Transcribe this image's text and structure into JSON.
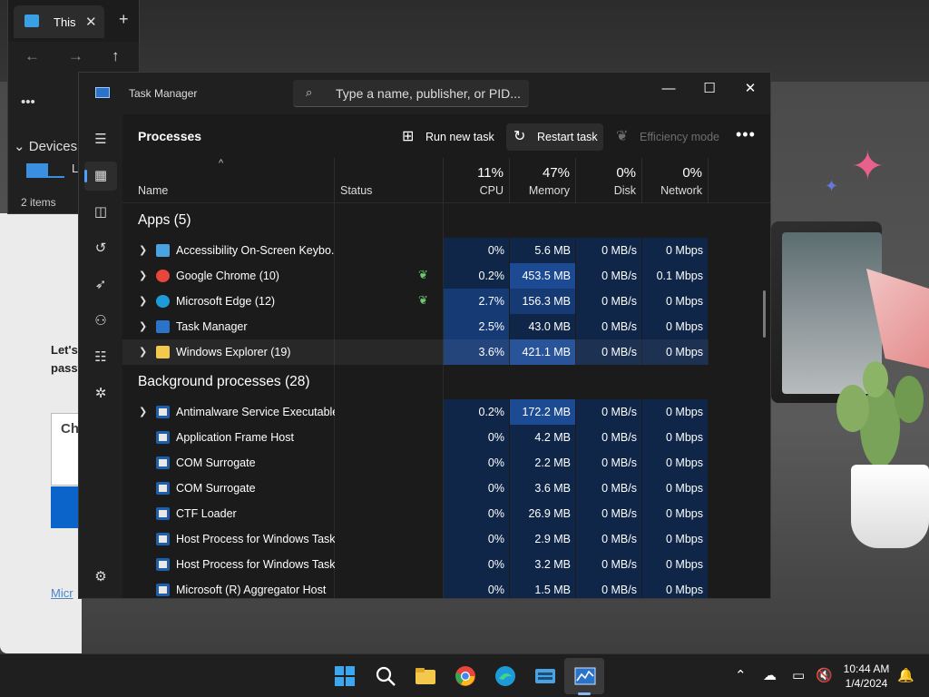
{
  "explorer": {
    "tab_title": "This",
    "section": "Devices a",
    "drive_label": "L",
    "items_count": "2 items"
  },
  "background": {
    "card_title": "Let's passv",
    "card_box_label": "Ch",
    "card_link": "Micr"
  },
  "task_manager": {
    "title": "Task Manager",
    "search_placeholder": "Type a name, publisher, or PID...",
    "page_heading": "Processes",
    "toolbar": {
      "run_new_task": "Run new task",
      "restart_task": "Restart task",
      "efficiency_mode": "Efficiency mode"
    },
    "columns": {
      "name": "Name",
      "status": "Status",
      "cpu_pct": "11%",
      "cpu": "CPU",
      "memory_pct": "47%",
      "memory": "Memory",
      "disk_pct": "0%",
      "disk": "Disk",
      "network_pct": "0%",
      "network": "Network"
    },
    "groups": {
      "apps": "Apps (5)",
      "background": "Background processes (28)"
    },
    "apps": [
      {
        "name": "Accessibility On-Screen Keybo...",
        "status": "",
        "cpu": "0%",
        "memory": "5.6 MB",
        "disk": "0 MB/s",
        "network": "0 Mbps",
        "icon": "keyboard-icon",
        "color": "#4aa3e0"
      },
      {
        "name": "Google Chrome (10)",
        "status": "efficiency-leaf-icon",
        "cpu": "0.2%",
        "memory": "453.5 MB",
        "disk": "0 MB/s",
        "network": "0.1 Mbps",
        "icon": "chrome-icon",
        "color": "#e8453c"
      },
      {
        "name": "Microsoft Edge (12)",
        "status": "efficiency-leaf-icon",
        "cpu": "2.7%",
        "memory": "156.3 MB",
        "disk": "0 MB/s",
        "network": "0 Mbps",
        "icon": "edge-icon",
        "color": "#1e9ad8"
      },
      {
        "name": "Task Manager",
        "status": "",
        "cpu": "2.5%",
        "memory": "43.0 MB",
        "disk": "0 MB/s",
        "network": "0 Mbps",
        "icon": "task-manager-icon",
        "color": "#2a73c9"
      },
      {
        "name": "Windows Explorer (19)",
        "status": "",
        "cpu": "3.6%",
        "memory": "421.1 MB",
        "disk": "0 MB/s",
        "network": "0 Mbps",
        "icon": "folder-icon",
        "color": "#f2c94c"
      }
    ],
    "background_processes": [
      {
        "name": "Antimalware Service Executable",
        "cpu": "0.2%",
        "memory": "172.2 MB",
        "disk": "0 MB/s",
        "network": "0 Mbps",
        "expandable": true
      },
      {
        "name": "Application Frame Host",
        "cpu": "0%",
        "memory": "4.2 MB",
        "disk": "0 MB/s",
        "network": "0 Mbps",
        "expandable": false
      },
      {
        "name": "COM Surrogate",
        "cpu": "0%",
        "memory": "2.2 MB",
        "disk": "0 MB/s",
        "network": "0 Mbps",
        "expandable": false
      },
      {
        "name": "COM Surrogate",
        "cpu": "0%",
        "memory": "3.6 MB",
        "disk": "0 MB/s",
        "network": "0 Mbps",
        "expandable": false
      },
      {
        "name": "CTF Loader",
        "cpu": "0%",
        "memory": "26.9 MB",
        "disk": "0 MB/s",
        "network": "0 Mbps",
        "expandable": false
      },
      {
        "name": "Host Process for Windows Tasks",
        "cpu": "0%",
        "memory": "2.9 MB",
        "disk": "0 MB/s",
        "network": "0 Mbps",
        "expandable": false
      },
      {
        "name": "Host Process for Windows Tasks",
        "cpu": "0%",
        "memory": "3.2 MB",
        "disk": "0 MB/s",
        "network": "0 Mbps",
        "expandable": false
      },
      {
        "name": "Microsoft (R) Aggregator Host",
        "cpu": "0%",
        "memory": "1.5 MB",
        "disk": "0 MB/s",
        "network": "0 Mbps",
        "expandable": false
      }
    ]
  },
  "taskbar": {
    "time": "10:44 AM",
    "date": "1/4/2024",
    "colors": {
      "accent": "#4fa0ff",
      "heat_low": "#0f2648",
      "heat_high": "#1c4a93"
    }
  }
}
